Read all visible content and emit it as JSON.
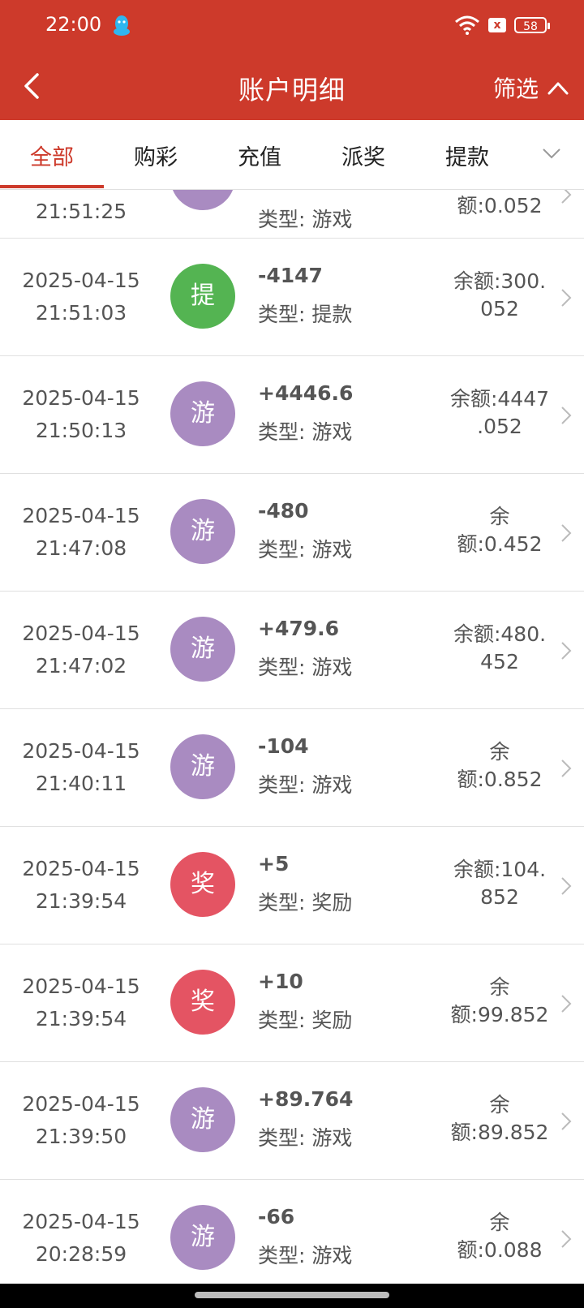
{
  "status": {
    "time": "22:00",
    "battery": "58",
    "sim_mark": "x"
  },
  "header": {
    "title": "账户明细",
    "filter_label": "筛选"
  },
  "tabs": [
    {
      "label": "全部",
      "active": true
    },
    {
      "label": "购彩"
    },
    {
      "label": "充值"
    },
    {
      "label": "派奖"
    },
    {
      "label": "提款"
    }
  ],
  "colors": {
    "brand": "#cd3a2b",
    "game": "#a98bc1",
    "withdraw": "#54b452",
    "reward": "#e45463"
  },
  "partial_row": {
    "time": "21:51:25",
    "badge": "游",
    "type": "类型: 游戏",
    "balance": "额:0.052"
  },
  "records": [
    {
      "date": "2025-04-15",
      "time": "21:51:03",
      "badge": "提",
      "kind": "withdraw",
      "amount": "-4147",
      "type": "类型: 提款",
      "balance_lines": [
        "余额:300.",
        "052"
      ]
    },
    {
      "date": "2025-04-15",
      "time": "21:50:13",
      "badge": "游",
      "kind": "game",
      "amount": "+4446.6",
      "type": "类型: 游戏",
      "balance_lines": [
        "余额:4447",
        ".052"
      ]
    },
    {
      "date": "2025-04-15",
      "time": "21:47:08",
      "badge": "游",
      "kind": "game",
      "amount": "-480",
      "type": "类型: 游戏",
      "balance_lines": [
        "余",
        "额:0.452"
      ]
    },
    {
      "date": "2025-04-15",
      "time": "21:47:02",
      "badge": "游",
      "kind": "game",
      "amount": "+479.6",
      "type": "类型: 游戏",
      "balance_lines": [
        "余额:480.",
        "452"
      ]
    },
    {
      "date": "2025-04-15",
      "time": "21:40:11",
      "badge": "游",
      "kind": "game",
      "amount": "-104",
      "type": "类型: 游戏",
      "balance_lines": [
        "余",
        "额:0.852"
      ]
    },
    {
      "date": "2025-04-15",
      "time": "21:39:54",
      "badge": "奖",
      "kind": "reward",
      "amount": "+5",
      "type": "类型: 奖励",
      "balance_lines": [
        "余额:104.",
        "852"
      ]
    },
    {
      "date": "2025-04-15",
      "time": "21:39:54",
      "badge": "奖",
      "kind": "reward",
      "amount": "+10",
      "type": "类型: 奖励",
      "balance_lines": [
        "余",
        "额:99.852"
      ]
    },
    {
      "date": "2025-04-15",
      "time": "21:39:50",
      "badge": "游",
      "kind": "game",
      "amount": "+89.764",
      "type": "类型: 游戏",
      "balance_lines": [
        "余",
        "额:89.852"
      ]
    },
    {
      "date": "2025-04-15",
      "time": "20:28:59",
      "badge": "游",
      "kind": "game",
      "amount": "-66",
      "type": "类型: 游戏",
      "balance_lines": [
        "余",
        "额:0.088"
      ]
    }
  ]
}
